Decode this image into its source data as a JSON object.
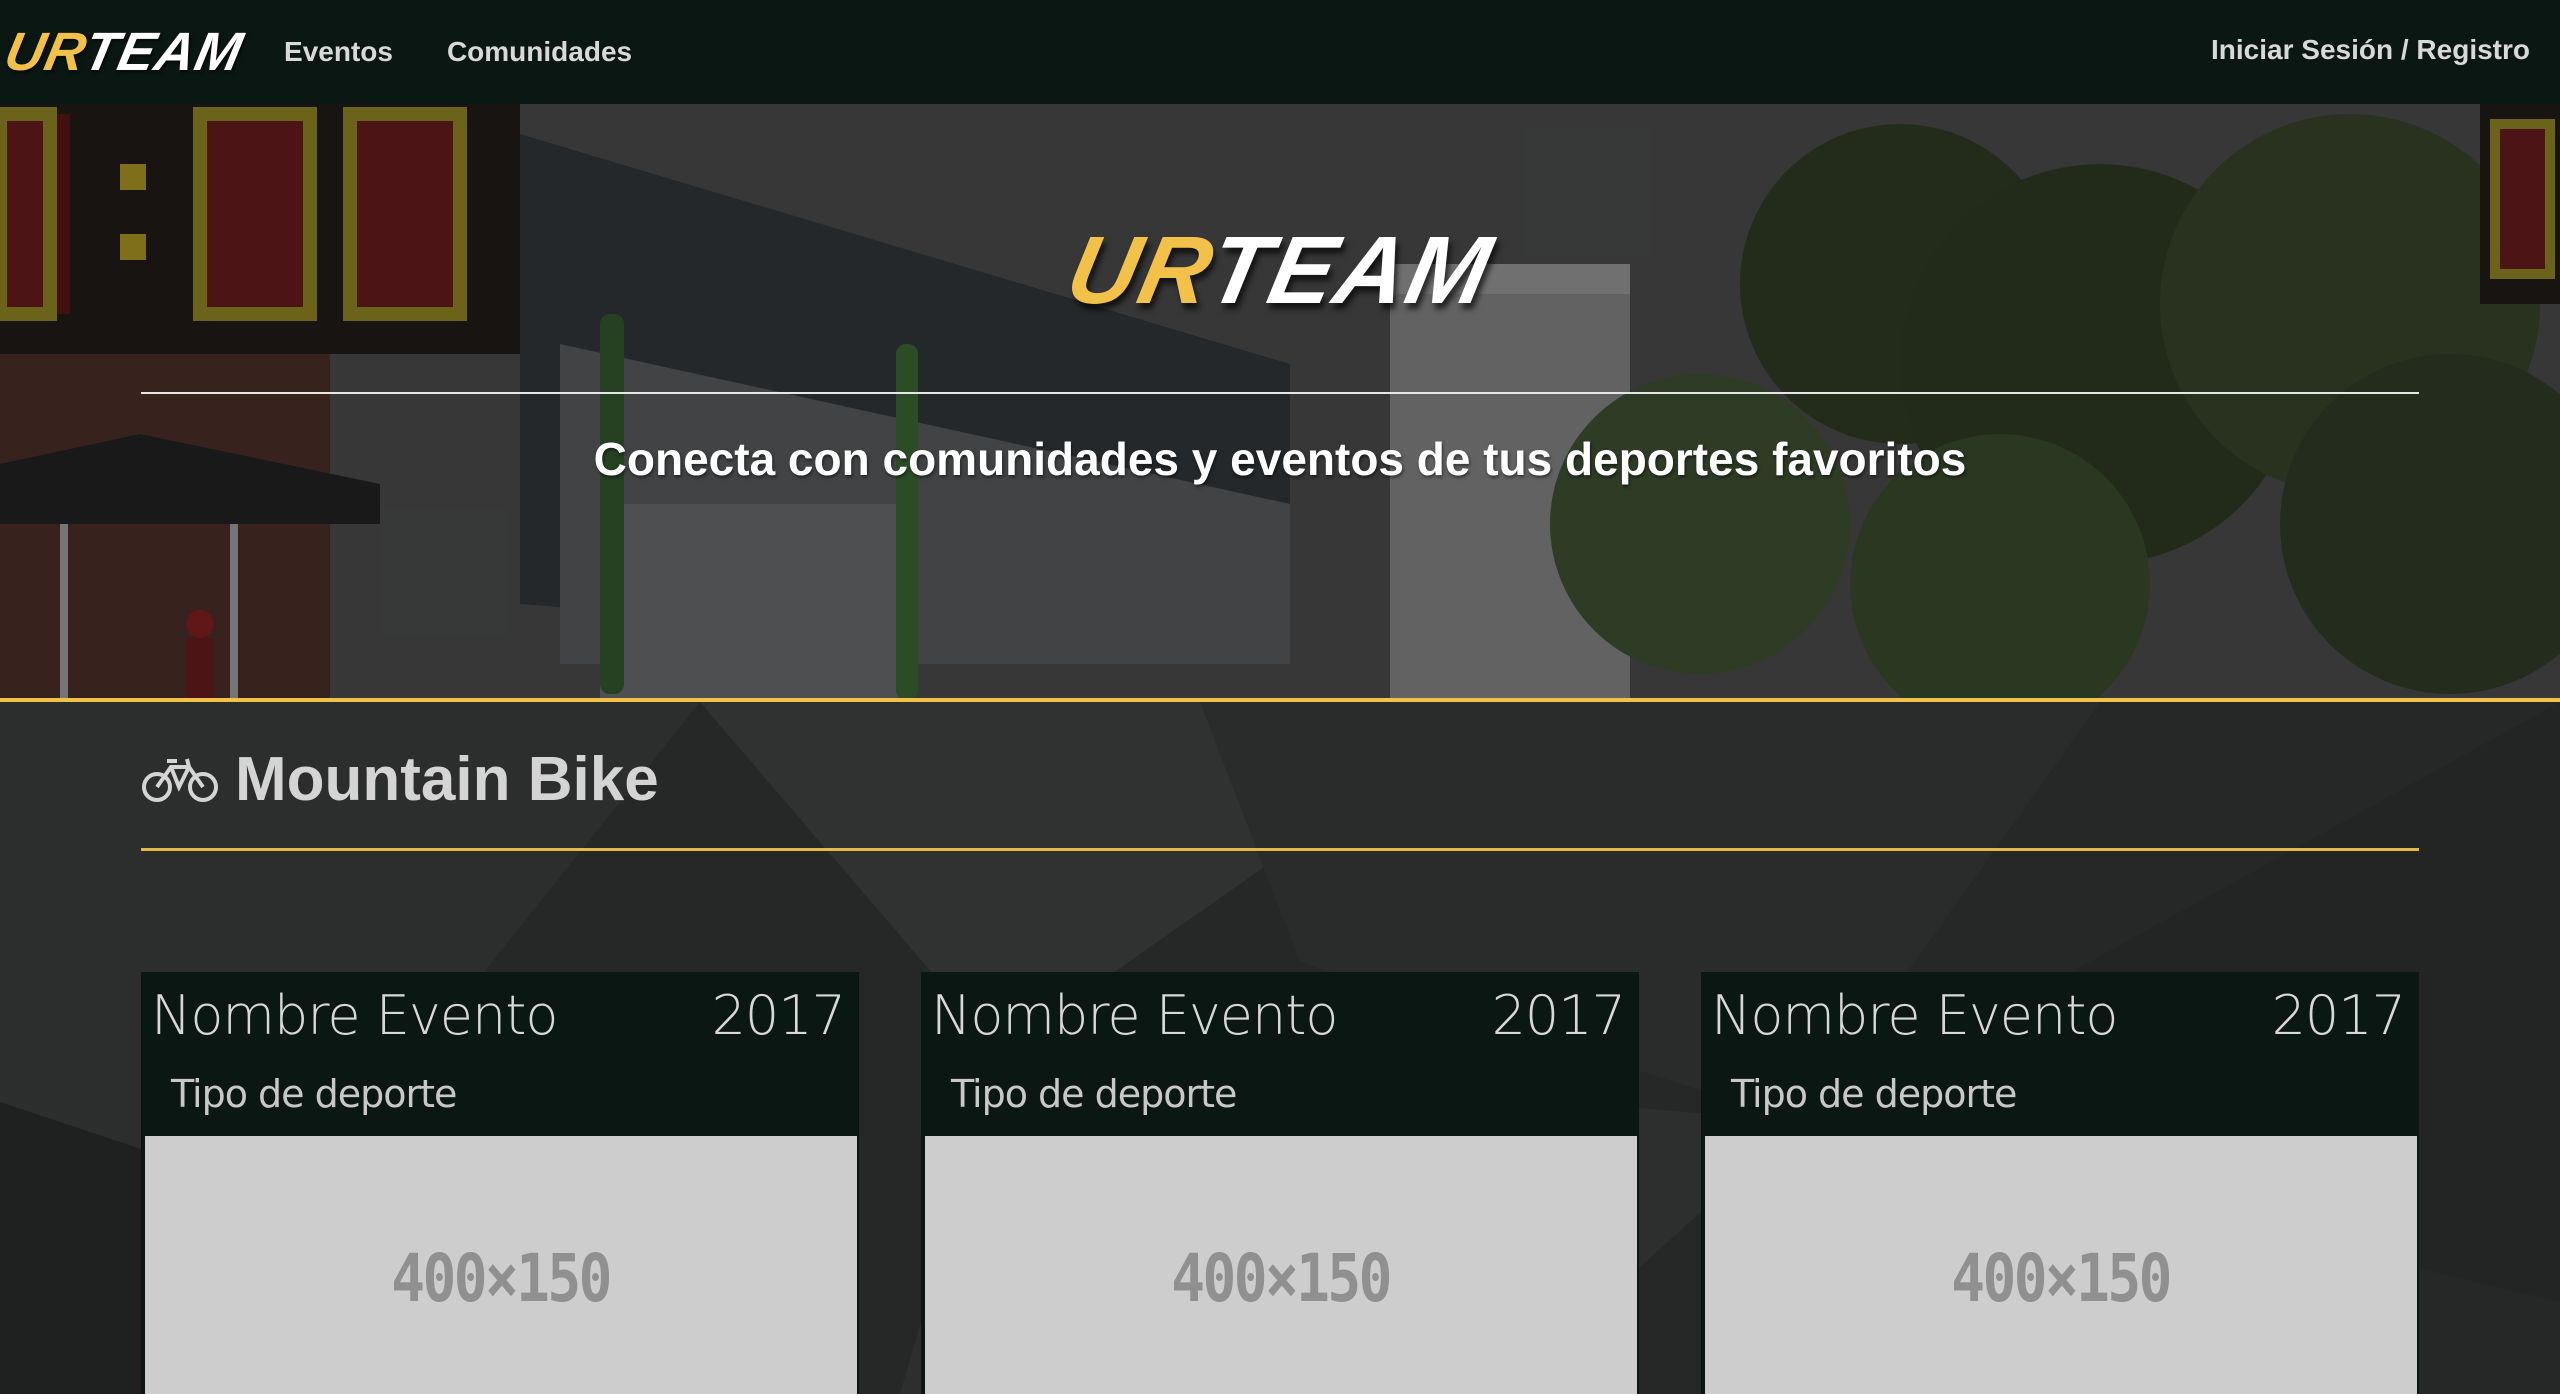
{
  "navbar": {
    "logo_ur": "UR",
    "logo_team": "TEAM",
    "links": [
      "Eventos",
      "Comunidades"
    ],
    "login": "Iniciar Sesión / Registro"
  },
  "hero": {
    "logo_ur": "UR",
    "logo_team": "TEAM",
    "tagline": "Conecta con comunidades y eventos de tus deportes favoritos"
  },
  "section": {
    "icon": "bicycle-icon",
    "title": "Mountain Bike"
  },
  "cards": [
    {
      "name": "Nombre Evento",
      "year": "2017",
      "sport": "Tipo de deporte",
      "image_label": "400×150"
    },
    {
      "name": "Nombre Evento",
      "year": "2017",
      "sport": "Tipo de deporte",
      "image_label": "400×150"
    },
    {
      "name": "Nombre Evento",
      "year": "2017",
      "sport": "Tipo de deporte",
      "image_label": "400×150"
    }
  ],
  "colors": {
    "nav_bg": "#0b1713",
    "accent_yellow": "#f2c14a",
    "card_bg": "#0b1713",
    "placeholder_bg": "#cdcdcd"
  }
}
